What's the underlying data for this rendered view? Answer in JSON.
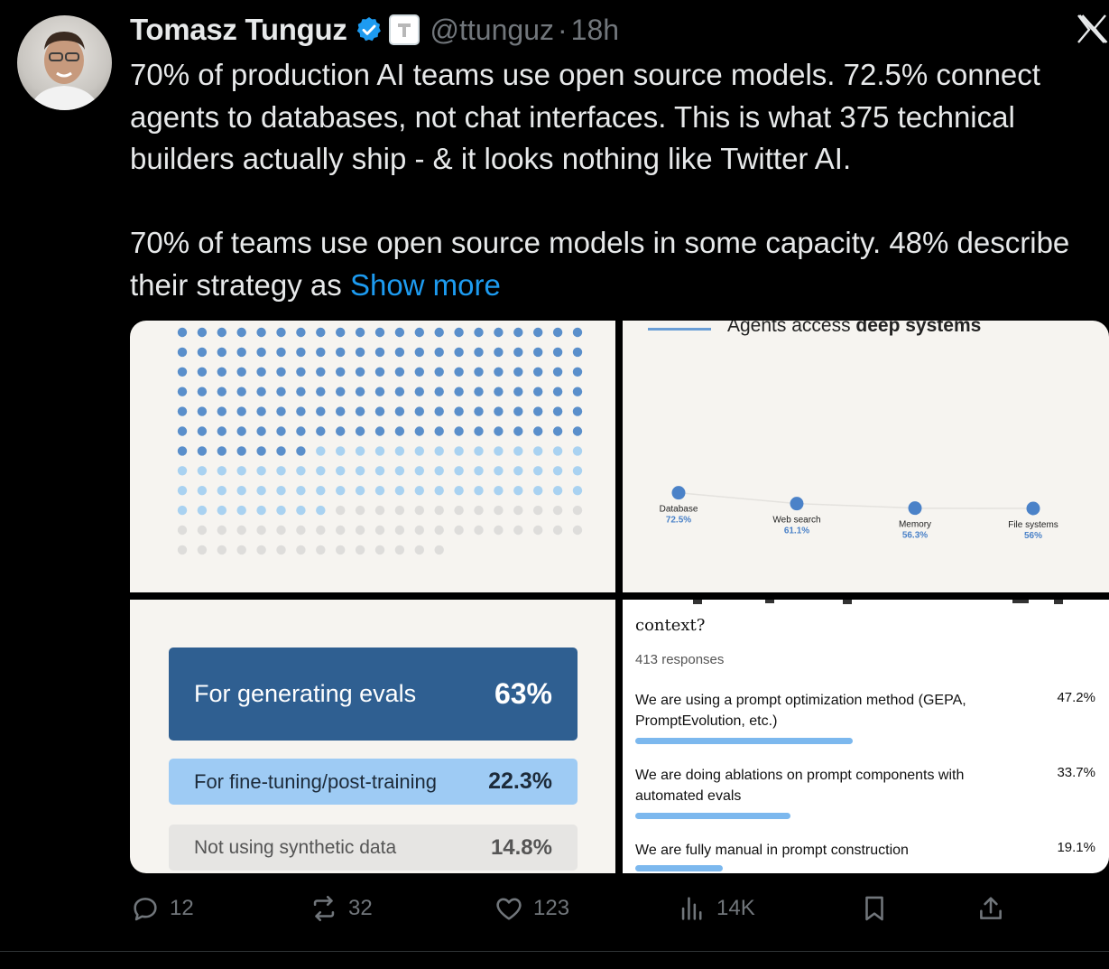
{
  "author": {
    "name": "Tomasz Tunguz",
    "handle": "@ttunguz",
    "separator": "·",
    "time": "18h"
  },
  "tweet": {
    "paragraph1": "70% of production AI teams use open source models. 72.5% connect agents to databases, not chat interfaces. This is what 375 technical builders actually ship - & it looks nothing like Twitter AI.",
    "paragraph2": "70% of teams use open source models in some capacity. 48% describe their strategy as",
    "show_more": "Show more"
  },
  "icons": {
    "verified": "verified-badge-icon",
    "affiliate": "affiliate-badge-icon",
    "brand": "x-logo-icon",
    "reply": "reply-icon",
    "repost": "repost-icon",
    "like": "heart-icon",
    "views": "views-icon",
    "bookmark": "bookmark-icon",
    "share": "share-icon"
  },
  "colors": {
    "accent": "#1d9bf0",
    "dot_dark": "#5a8fcb",
    "dot_light": "#a9d2f1",
    "dot_grey": "#dedddb",
    "evals_bg": "#2f5f91",
    "finetune_bg": "#9ecbf4",
    "none_bg": "#e6e5e3"
  },
  "media": {
    "waffle": {
      "dark_count": 133,
      "light_count": 64,
      "grey_count": 48
    },
    "line_chart": {
      "title_prefix": "Agents access ",
      "title_bold": "deep systems"
    },
    "synthetic": {
      "items": [
        {
          "label": "For generating evals",
          "value": "63%"
        },
        {
          "label": "For fine-tuning/post-training",
          "value": "22.3%"
        },
        {
          "label": "Not using synthetic data",
          "value": "14.8%"
        }
      ]
    },
    "form": {
      "question": "context?",
      "responses": "413 responses",
      "options": [
        {
          "label": "We are using a prompt optimization method (GEPA, PromptEvolution, etc.)",
          "value": "47.2%",
          "fraction": 0.472
        },
        {
          "label": "We are doing ablations on prompt components with automated evals",
          "value": "33.7%",
          "fraction": 0.337
        },
        {
          "label": "We are fully manual in prompt construction",
          "value": "19.1%",
          "fraction": 0.191
        }
      ]
    }
  },
  "chart_data": {
    "type": "line",
    "title": "Agents access deep systems",
    "categories": [
      "Database",
      "Web search",
      "Memory",
      "File systems"
    ],
    "values": [
      72.5,
      61.1,
      56.3,
      56
    ],
    "value_labels": [
      "72.5%",
      "61.1%",
      "56.3%",
      "56%"
    ],
    "ylim": [
      0,
      100
    ]
  },
  "actions": {
    "replies": "12",
    "reposts": "32",
    "likes": "123",
    "views": "14K"
  }
}
